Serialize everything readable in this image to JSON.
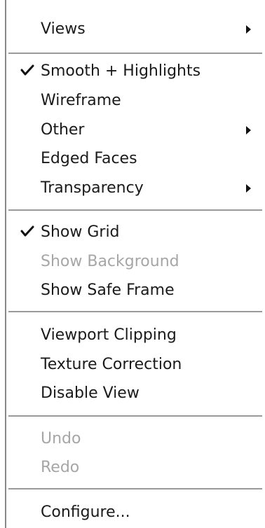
{
  "menu": {
    "items": [
      {
        "label": "Views",
        "icon": "submenu-arrow-icon"
      },
      {
        "label": "Smooth + Highlights",
        "checked": true,
        "icon": "checkmark-icon"
      },
      {
        "label": "Wireframe"
      },
      {
        "label": "Other",
        "icon": "submenu-arrow-icon"
      },
      {
        "label": "Edged Faces"
      },
      {
        "label": "Transparency",
        "icon": "submenu-arrow-icon"
      },
      {
        "label": "Show Grid",
        "checked": true,
        "icon": "checkmark-icon"
      },
      {
        "label": "Show Background",
        "disabled": true
      },
      {
        "label": "Show Safe Frame"
      },
      {
        "label": "Viewport Clipping"
      },
      {
        "label": "Texture Correction"
      },
      {
        "label": "Disable View"
      },
      {
        "label": "Undo",
        "disabled": true
      },
      {
        "label": "Redo",
        "disabled": true
      },
      {
        "label": "Configure..."
      }
    ]
  },
  "colors": {
    "text": "#1a1a1a",
    "disabled_text": "#a6a6a6",
    "separator": "#9a9a9a",
    "background": "#ffffff"
  }
}
